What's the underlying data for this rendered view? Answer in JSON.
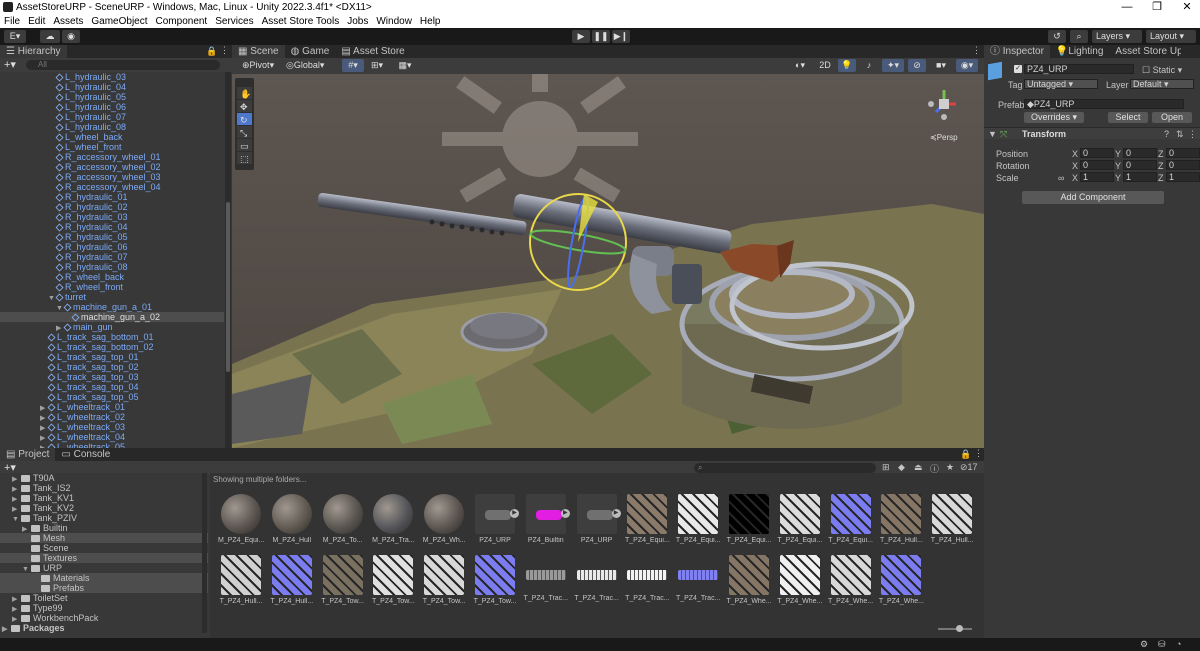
{
  "window": {
    "title": "AssetStoreURP - SceneURP - Windows, Mac, Linux - Unity 2022.3.4f1* <DX11>",
    "minimize": "—",
    "maximize": "❐",
    "close": "✕"
  },
  "menu": [
    "File",
    "Edit",
    "Assets",
    "GameObject",
    "Component",
    "Services",
    "Asset Store Tools",
    "Jobs",
    "Window",
    "Help"
  ],
  "toolbar": {
    "account": "E",
    "layers": "Layers",
    "layout": "Layout"
  },
  "hierarchy": {
    "tab": "Hierarchy",
    "search_placeholder": "All",
    "items": [
      {
        "label": "L_hydraulic_03",
        "indent": 3
      },
      {
        "label": "L_hydraulic_04",
        "indent": 3
      },
      {
        "label": "L_hydraulic_05",
        "indent": 3
      },
      {
        "label": "L_hydraulic_06",
        "indent": 3
      },
      {
        "label": "L_hydraulic_07",
        "indent": 3
      },
      {
        "label": "L_hydraulic_08",
        "indent": 3
      },
      {
        "label": "L_wheel_back",
        "indent": 3
      },
      {
        "label": "L_wheel_front",
        "indent": 3
      },
      {
        "label": "R_accessory_wheel_01",
        "indent": 3
      },
      {
        "label": "R_accessory_wheel_02",
        "indent": 3
      },
      {
        "label": "R_accessory_wheel_03",
        "indent": 3
      },
      {
        "label": "R_accessory_wheel_04",
        "indent": 3
      },
      {
        "label": "R_hydraulic_01",
        "indent": 3
      },
      {
        "label": "R_hydraulic_02",
        "indent": 3
      },
      {
        "label": "R_hydraulic_03",
        "indent": 3
      },
      {
        "label": "R_hydraulic_04",
        "indent": 3
      },
      {
        "label": "R_hydraulic_05",
        "indent": 3
      },
      {
        "label": "R_hydraulic_06",
        "indent": 3
      },
      {
        "label": "R_hydraulic_07",
        "indent": 3
      },
      {
        "label": "R_hydraulic_08",
        "indent": 3
      },
      {
        "label": "R_wheel_back",
        "indent": 3
      },
      {
        "label": "R_wheel_front",
        "indent": 3
      },
      {
        "label": "turret",
        "indent": 3,
        "arrow": "▼"
      },
      {
        "label": "machine_gun_a_01",
        "indent": 4,
        "arrow": "▼"
      },
      {
        "label": "machine_gun_a_02",
        "indent": 5,
        "selected": true
      },
      {
        "label": "main_gun",
        "indent": 4,
        "arrow": "▶"
      },
      {
        "label": "L_track_sag_bottom_01",
        "indent": 2
      },
      {
        "label": "L_track_sag_bottom_02",
        "indent": 2
      },
      {
        "label": "L_track_sag_top_01",
        "indent": 2
      },
      {
        "label": "L_track_sag_top_02",
        "indent": 2
      },
      {
        "label": "L_track_sag_top_03",
        "indent": 2
      },
      {
        "label": "L_track_sag_top_04",
        "indent": 2
      },
      {
        "label": "L_track_sag_top_05",
        "indent": 2
      },
      {
        "label": "L_wheeltrack_01",
        "indent": 2,
        "arrow": "▶"
      },
      {
        "label": "L_wheeltrack_02",
        "indent": 2,
        "arrow": "▶"
      },
      {
        "label": "L_wheeltrack_03",
        "indent": 2,
        "arrow": "▶"
      },
      {
        "label": "L_wheeltrack_04",
        "indent": 2,
        "arrow": "▶"
      },
      {
        "label": "L_wheeltrack_05",
        "indent": 2,
        "arrow": "▶"
      }
    ]
  },
  "scene": {
    "tabs": [
      "Scene",
      "Game",
      "Asset Store"
    ],
    "pivot": "Pivot",
    "global": "Global",
    "mode_2d": "2D",
    "persp": "Persp"
  },
  "inspector": {
    "tabs": [
      "Inspector",
      "Lighting",
      "Asset Store Upload"
    ],
    "object_name": "PZ4_URP",
    "static_label": "Static",
    "tag_label": "Tag",
    "tag_value": "Untagged",
    "layer_label": "Layer",
    "layer_value": "Default",
    "prefab_label": "Prefab",
    "prefab_value": "PZ4_URP",
    "overrides": "Overrides",
    "select": "Select",
    "open": "Open",
    "transform_title": "Transform",
    "position_label": "Position",
    "rotation_label": "Rotation",
    "scale_label": "Scale",
    "axis_x": "X",
    "axis_y": "Y",
    "axis_z": "Z",
    "position": [
      "0",
      "0",
      "0"
    ],
    "rotation": [
      "0",
      "0",
      "0"
    ],
    "scale": [
      "1",
      "1",
      "1"
    ],
    "add_component": "Add Component"
  },
  "project": {
    "tabs": [
      "Project",
      "Console"
    ],
    "showing": "Showing multiple folders...",
    "hidden_count": "17",
    "tree": [
      {
        "label": "T90A",
        "indent": 1,
        "arrow": "▶"
      },
      {
        "label": "Tank_IS2",
        "indent": 1,
        "arrow": "▶"
      },
      {
        "label": "Tank_KV1",
        "indent": 1,
        "arrow": "▶"
      },
      {
        "label": "Tank_KV2",
        "indent": 1,
        "arrow": "▶"
      },
      {
        "label": "Tank_PZIV",
        "indent": 1,
        "arrow": "▼"
      },
      {
        "label": "Builtin",
        "indent": 2,
        "arrow": "▶"
      },
      {
        "label": "Mesh",
        "indent": 2,
        "highlight": true
      },
      {
        "label": "Scene",
        "indent": 2
      },
      {
        "label": "Textures",
        "indent": 2,
        "highlight": true
      },
      {
        "label": "URP",
        "indent": 2,
        "arrow": "▼"
      },
      {
        "label": "Materials",
        "indent": 3,
        "highlight": true
      },
      {
        "label": "Prefabs",
        "indent": 3,
        "highlight": true
      },
      {
        "label": "ToiletSet",
        "indent": 1,
        "arrow": "▶"
      },
      {
        "label": "Type99",
        "indent": 1,
        "arrow": "▶"
      },
      {
        "label": "WorkbenchPack",
        "indent": 1,
        "arrow": "▶"
      },
      {
        "label": "Packages",
        "indent": 0,
        "arrow": "▶",
        "bold": true
      }
    ],
    "assets_row1": [
      {
        "label": "M_PZ4_Equi...",
        "kind": "sphere",
        "color": "#5c5550"
      },
      {
        "label": "M_PZ4_Hull",
        "kind": "sphere",
        "color": "#615a52"
      },
      {
        "label": "M_PZ4_To...",
        "kind": "sphere",
        "color": "#5a5550"
      },
      {
        "label": "M_PZ4_Tra...",
        "kind": "sphere",
        "color": "#55555a"
      },
      {
        "label": "M_PZ4_Wh...",
        "kind": "sphere",
        "color": "#5c5550"
      },
      {
        "label": "PZ4_URP",
        "kind": "mesh",
        "color": "#4a4a4a"
      },
      {
        "label": "PZ4_Builtin",
        "kind": "magenta",
        "color": "#e31ee3"
      },
      {
        "label": "PZ4_URP",
        "kind": "mesh",
        "color": "#4a4a4a"
      },
      {
        "label": "T_PZ4_Equi...",
        "kind": "tex",
        "color": "#8a7a6a"
      },
      {
        "label": "T_PZ4_Equi...",
        "kind": "tex",
        "color": "#e8e8e8"
      },
      {
        "label": "T_PZ4_Equi...",
        "kind": "tex",
        "color": "#000000"
      },
      {
        "label": "T_PZ4_Equi...",
        "kind": "tex",
        "color": "#dcdcdc"
      },
      {
        "label": "T_PZ4_Equi...",
        "kind": "tex",
        "color": "#7a7cf0"
      },
      {
        "label": "T_PZ4_Hull...",
        "kind": "tex",
        "color": "#857565"
      },
      {
        "label": "T_PZ4_Hull...",
        "kind": "tex",
        "color": "#d8d8d8"
      }
    ],
    "assets_row2": [
      {
        "label": "T_PZ4_Hull...",
        "kind": "tex",
        "color": "#d0d0d0"
      },
      {
        "label": "T_PZ4_Hull...",
        "kind": "tex",
        "color": "#7a7cf0"
      },
      {
        "label": "T_PZ4_Tow...",
        "kind": "tex",
        "color": "#7a7060"
      },
      {
        "label": "T_PZ4_Tow...",
        "kind": "tex",
        "color": "#e0e0e0"
      },
      {
        "label": "T_PZ4_Tow...",
        "kind": "tex",
        "color": "#d8d8d8"
      },
      {
        "label": "T_PZ4_Tow...",
        "kind": "tex",
        "color": "#7a7cf0"
      },
      {
        "label": "T_PZ4_Trac...",
        "kind": "strip",
        "color": "#9a9a9a"
      },
      {
        "label": "T_PZ4_Trac...",
        "kind": "strip",
        "color": "#e8e8e8"
      },
      {
        "label": "T_PZ4_Trac...",
        "kind": "strip",
        "color": "#f2f2f2"
      },
      {
        "label": "T_PZ4_Trac...",
        "kind": "strip",
        "color": "#8080f0"
      },
      {
        "label": "T_PZ4_Whe...",
        "kind": "tex",
        "color": "#857565"
      },
      {
        "label": "T_PZ4_Whe...",
        "kind": "tex",
        "color": "#f0f0f0"
      },
      {
        "label": "T_PZ4_Whe...",
        "kind": "tex",
        "color": "#d8d8d8"
      },
      {
        "label": "T_PZ4_Whe...",
        "kind": "tex",
        "color": "#7a7cf0"
      }
    ]
  },
  "colors": {
    "accent": "#4d78cc",
    "hierarchy_text": "#7baaf7",
    "gizmo_yellow": "#ffee33"
  }
}
